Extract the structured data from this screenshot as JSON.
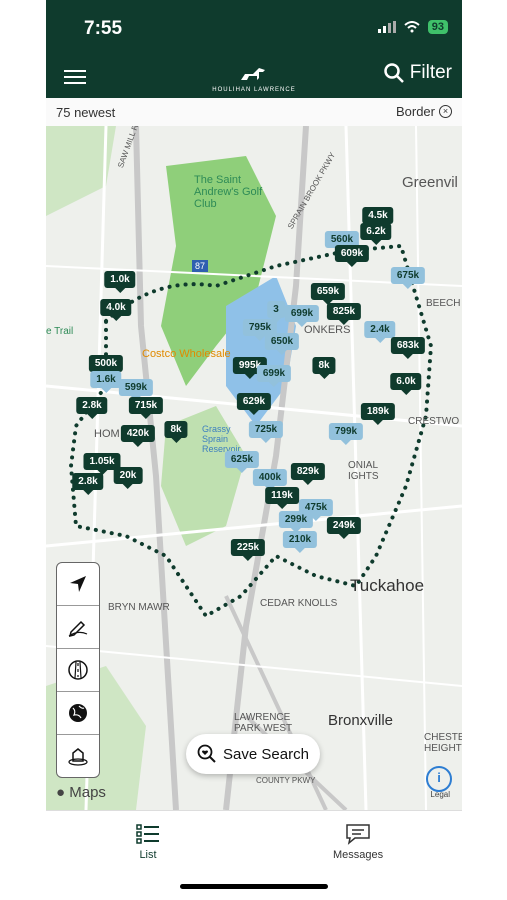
{
  "status": {
    "time": "7:55",
    "battery": "93"
  },
  "header": {
    "logo_text": "HOULIHAN LAWRENCE",
    "filter_label": "Filter"
  },
  "infobar": {
    "count_label": "75 newest",
    "border_label": "Border",
    "clear_icon": "x-circle-icon"
  },
  "map": {
    "labels": [
      "Greenvil",
      "The Saint Andrew's Golf Club",
      "BEECH",
      "CRESTWO",
      "Tuckahoe",
      "CEDAR KNOLLS",
      "BRYN MAWR",
      "Bronxville",
      "LAWRENCE PARK WEST",
      "CHESTE HEIGHT",
      "Costco Wholesale",
      "Grassy Sprain Reservoir",
      "e Trail",
      "ONIAL IGHTS",
      "HOM",
      "ONKERS",
      "SAW MILL RIVER PKWY",
      "SPRAIN BROOK PKWY",
      "87",
      "COUNTY PKWY"
    ],
    "pins": [
      {
        "label": "4.5k",
        "style": "dark"
      },
      {
        "label": "6.2k",
        "style": "dark"
      },
      {
        "label": "560k",
        "style": "light"
      },
      {
        "label": "609k",
        "style": "dark"
      },
      {
        "label": "675k",
        "style": "light"
      },
      {
        "label": "1.0k",
        "style": "dark"
      },
      {
        "label": "4.0k",
        "style": "dark"
      },
      {
        "label": "659k",
        "style": "dark"
      },
      {
        "label": "3",
        "style": "light"
      },
      {
        "label": "699k",
        "style": "light"
      },
      {
        "label": "825k",
        "style": "dark"
      },
      {
        "label": "795k",
        "style": "light"
      },
      {
        "label": "2.4k",
        "style": "light"
      },
      {
        "label": "650k",
        "style": "light"
      },
      {
        "label": "683k",
        "style": "dark"
      },
      {
        "label": "500k",
        "style": "dark"
      },
      {
        "label": "1.6k",
        "style": "light"
      },
      {
        "label": "599k",
        "style": "light"
      },
      {
        "label": "995k",
        "style": "dark"
      },
      {
        "label": "699k",
        "style": "light"
      },
      {
        "label": "8k",
        "style": "dark"
      },
      {
        "label": "6.0k",
        "style": "dark"
      },
      {
        "label": "2.8k",
        "style": "dark"
      },
      {
        "label": "715k",
        "style": "dark"
      },
      {
        "label": "629k",
        "style": "dark"
      },
      {
        "label": "189k",
        "style": "dark"
      },
      {
        "label": "420k",
        "style": "dark"
      },
      {
        "label": "8k",
        "style": "dark"
      },
      {
        "label": "725k",
        "style": "light"
      },
      {
        "label": "799k",
        "style": "light"
      },
      {
        "label": "1.05k",
        "style": "dark"
      },
      {
        "label": "625k",
        "style": "light"
      },
      {
        "label": "829k",
        "style": "dark"
      },
      {
        "label": "20k",
        "style": "dark"
      },
      {
        "label": "400k",
        "style": "light"
      },
      {
        "label": "2.8k",
        "style": "dark"
      },
      {
        "label": "119k",
        "style": "dark"
      },
      {
        "label": "475k",
        "style": "light"
      },
      {
        "label": "299k",
        "style": "light"
      },
      {
        "label": "249k",
        "style": "dark"
      },
      {
        "label": "225k",
        "style": "dark"
      },
      {
        "label": "210k",
        "style": "light"
      }
    ]
  },
  "tools": [
    "location-arrow-icon",
    "draw-pencil-icon",
    "road-map-icon",
    "satellite-globe-icon",
    "3d-building-icon"
  ],
  "save_search": {
    "label": "Save Search"
  },
  "attribution": {
    "maps": "Maps",
    "legal": "Legal"
  },
  "bottom_nav": [
    {
      "label": "List",
      "icon": "list-icon",
      "active": true
    },
    {
      "label": "Messages",
      "icon": "messages-icon",
      "active": false
    }
  ],
  "colors": {
    "brand": "#0f3b2d",
    "accent_light": "#92c1dc",
    "active_tab": "#0f3b2d"
  }
}
